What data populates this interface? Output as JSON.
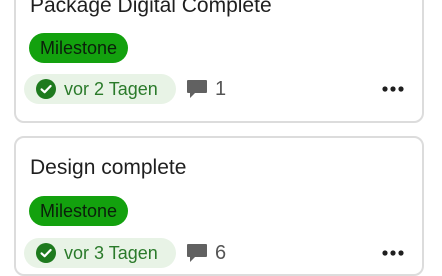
{
  "cards": [
    {
      "title": "Package Digital Complete",
      "tag": "Milestone",
      "due": "vor 2 Tagen",
      "comments": "1"
    },
    {
      "title": "Design complete",
      "tag": "Milestone",
      "due": "vor 3 Tagen",
      "comments": "6"
    }
  ],
  "colors": {
    "tag_background": "#13a10e",
    "due_background": "#e8f3e6",
    "due_text": "#2a7a2a",
    "check_icon": "#1e7a1e",
    "card_border": "#dcdcdc"
  },
  "icons": {
    "due": "check-circle-icon",
    "comments": "comment-icon",
    "menu": "more-horizontal-icon"
  }
}
